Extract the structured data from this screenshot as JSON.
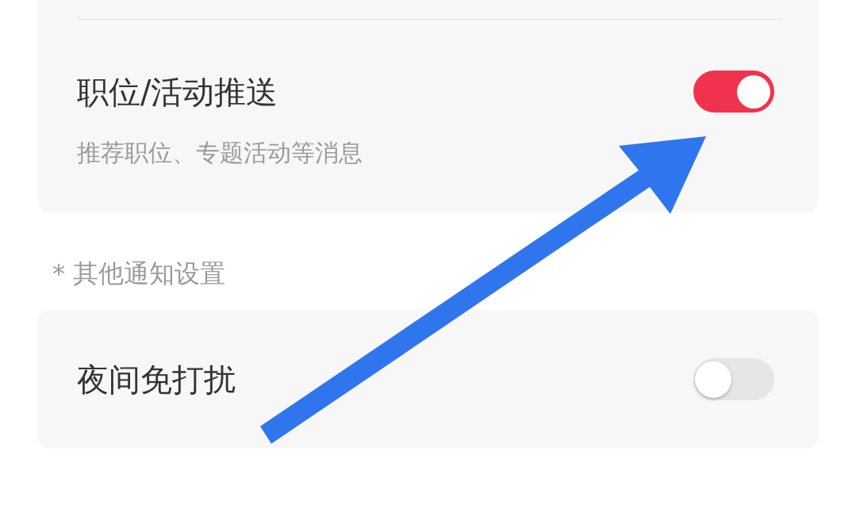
{
  "push_group": {
    "items": [
      {
        "title": "职位/活动推送",
        "description": "推荐职位、专题活动等消息",
        "on": true
      }
    ]
  },
  "other_section": {
    "header": "* 其他通知设置",
    "items": [
      {
        "title": "夜间免打扰",
        "on": false
      }
    ]
  }
}
